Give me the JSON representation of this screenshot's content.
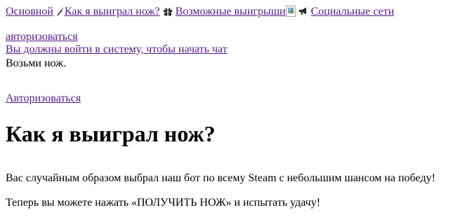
{
  "nav": {
    "items": [
      {
        "label": "Основной",
        "icon": null
      },
      {
        "label": "Как я выиграл нож?",
        "icon": "knife-icon"
      },
      {
        "label": "Возможные выигрыши",
        "icon": "gift-icon"
      },
      {
        "label": "Социальные сети",
        "icon": "megaphone-icon"
      }
    ],
    "broken_image": "broken-image-icon"
  },
  "auth": {
    "login_link": "авторизоваться",
    "chat_notice": "Вы должны войти в систему, чтобы начать чат",
    "take_knife": "Возьми нож.",
    "login_link_2": "Авторизоваться"
  },
  "main": {
    "title": "Как я выиграл нож?",
    "paragraph_1": "Вас случайным образом выбрал наш бот по всему Steam с небольшим шансом на победу!",
    "paragraph_2": "Теперь вы можете нажать «ПОЛУЧИТЬ НОЖ» и испытать удачу!"
  },
  "colors": {
    "link": "#551a8b",
    "text": "#000000",
    "background": "#ffffff"
  }
}
